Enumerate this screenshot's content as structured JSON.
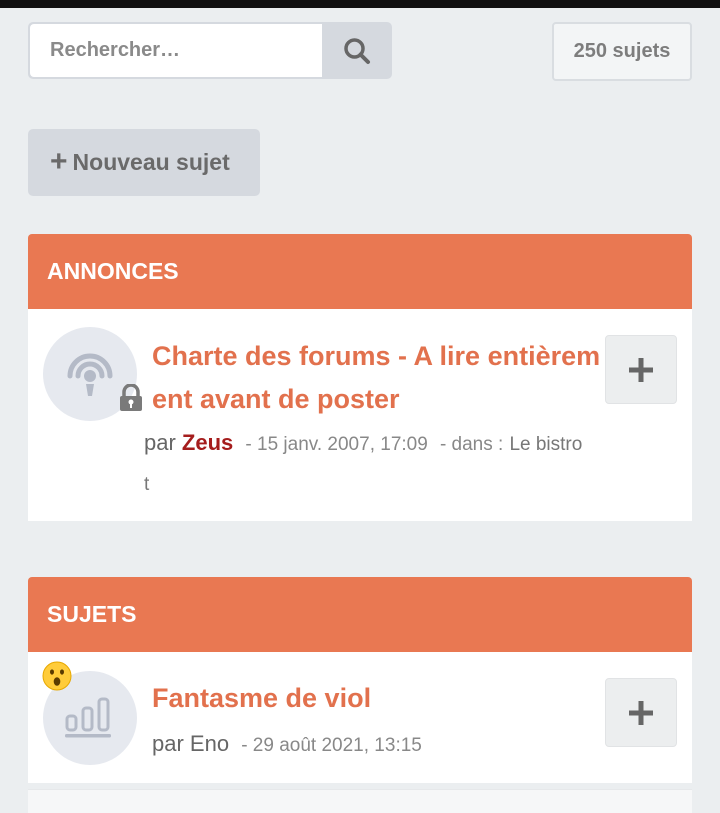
{
  "search": {
    "placeholder": "Rechercher…",
    "icon": "search-icon"
  },
  "topic_count": "250 sujets",
  "new_topic": {
    "plus": "+",
    "label": "Nouveau sujet"
  },
  "announcements": {
    "header": "ANNONCES",
    "items": [
      {
        "title_line1": "Charte des forums - A lire entièrem",
        "title_line2": "ent avant de poster",
        "by": "par",
        "author": "Zeus",
        "date": "- 15 janv. 2007, 17:09",
        "in_label": "- dans :",
        "forum_line1": "Le bistro",
        "forum_line2": "t",
        "icon": "podcast-icon",
        "locked": true
      }
    ]
  },
  "topics": {
    "header": "SUJETS",
    "items": [
      {
        "title": "Fantasme de viol",
        "by": "par",
        "author": "Eno",
        "date": "- 29 août 2021, 13:15",
        "icon": "bar-chart-icon",
        "emoji": "surprised-face-icon"
      }
    ]
  },
  "colors": {
    "accent": "#e97852",
    "title": "#e2714d",
    "admin": "#a51d1d",
    "background": "#ebeef0"
  }
}
